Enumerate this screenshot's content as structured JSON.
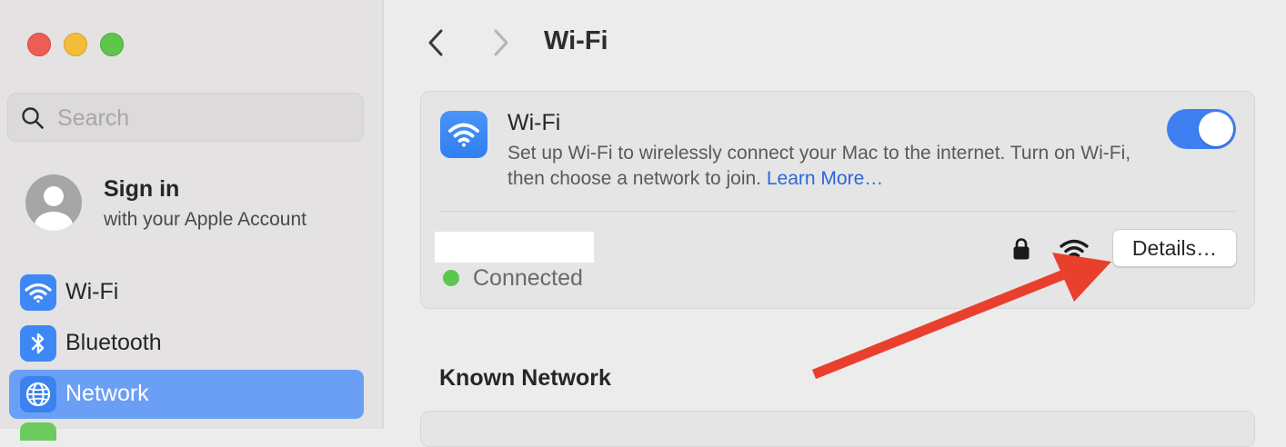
{
  "window": {
    "traffic_lights": [
      "close",
      "minimize",
      "zoom"
    ]
  },
  "sidebar": {
    "search": {
      "placeholder": "Search",
      "value": ""
    },
    "account": {
      "title": "Sign in",
      "subtitle": "with your Apple Account"
    },
    "items": [
      {
        "label": "Wi-Fi",
        "icon": "wifi-icon",
        "selected": false
      },
      {
        "label": "Bluetooth",
        "icon": "bluetooth-icon",
        "selected": false
      },
      {
        "label": "Network",
        "icon": "globe-icon",
        "selected": true
      }
    ]
  },
  "header": {
    "title": "Wi-Fi"
  },
  "wifi_card": {
    "title": "Wi-Fi",
    "description": "Set up Wi-Fi to wirelessly connect your Mac to the internet. Turn on Wi-Fi, then choose a network to join.",
    "learn_more_label": "Learn More…",
    "enabled": true,
    "current_network": {
      "name": "",
      "status": "Connected",
      "secured": true,
      "details_label": "Details…"
    }
  },
  "known_networks": {
    "heading": "Known Network"
  },
  "colors": {
    "accent": "#3d7ff1",
    "sidebar_selected": "#6b9ff6",
    "connected_dot": "#5dc64e",
    "annotation_arrow": "#e8402c"
  }
}
